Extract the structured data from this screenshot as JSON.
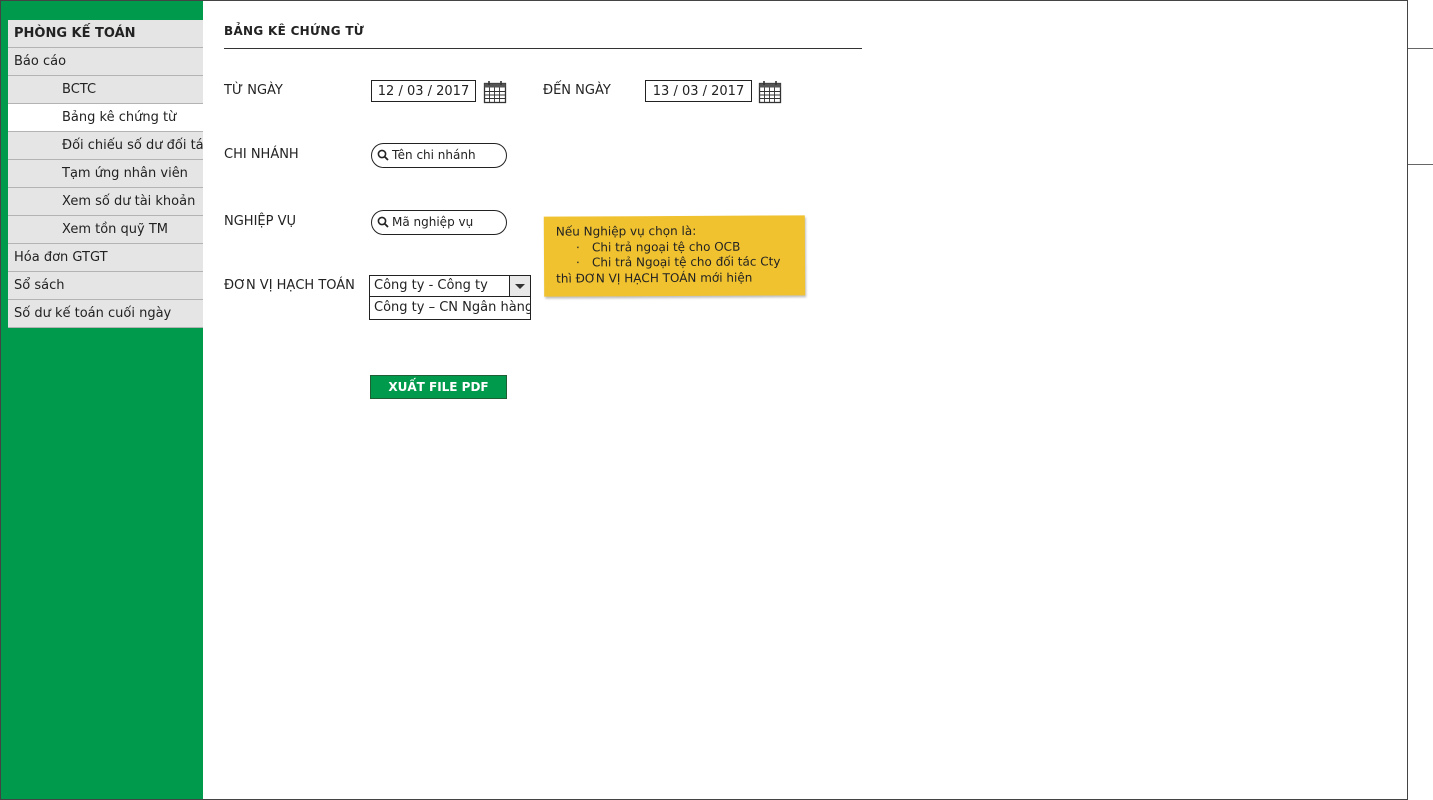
{
  "sidebar": {
    "header": "PHÒNG KẾ TOÁN",
    "items": [
      {
        "label": "Báo cáo"
      },
      {
        "label": "BCTC"
      },
      {
        "label": "Bảng kê chứng từ"
      },
      {
        "label": "Đối chiếu số dư đối tác"
      },
      {
        "label": "Tạm ứng nhân viên"
      },
      {
        "label": "Xem số dư tài khoản"
      },
      {
        "label": "Xem tồn quỹ TM"
      },
      {
        "label": "Hóa đơn GTGT"
      },
      {
        "label": "Sổ sách"
      },
      {
        "label": "Số dư kế toán cuối ngày"
      }
    ]
  },
  "page": {
    "title": "BẢNG KÊ CHỨNG TỪ"
  },
  "form": {
    "from_date": {
      "label": "TỪ NGÀY",
      "value": "12 / 03 / 2017"
    },
    "to_date": {
      "label": "ĐẾN NGÀY",
      "value": "13 / 03 / 2017"
    },
    "branch": {
      "label": "CHI NHÁNH",
      "placeholder": "Tên chi nhánh"
    },
    "operation": {
      "label": "NGHIỆP VỤ",
      "placeholder": "Mã nghiệp vụ"
    },
    "accounting_unit": {
      "label": "ĐƠN VỊ HẠCH TOÁN",
      "selected": "Công ty - Công ty",
      "options": [
        "Công ty – CN Ngân hàng"
      ]
    },
    "export_label": "XUẤT FILE PDF"
  },
  "note": {
    "intro": "Nếu Nghiệp vụ chọn là:",
    "bullets": [
      "Chi trả ngoại tệ cho OCB",
      "Chi trả Ngoại tệ cho đối tác Cty"
    ],
    "outro": "thì ĐƠN VỊ HẠCH TOÁN mới hiện"
  },
  "colors": {
    "sidebar": "#009a4c",
    "note": "#f0c230",
    "button": "#009a4c"
  }
}
